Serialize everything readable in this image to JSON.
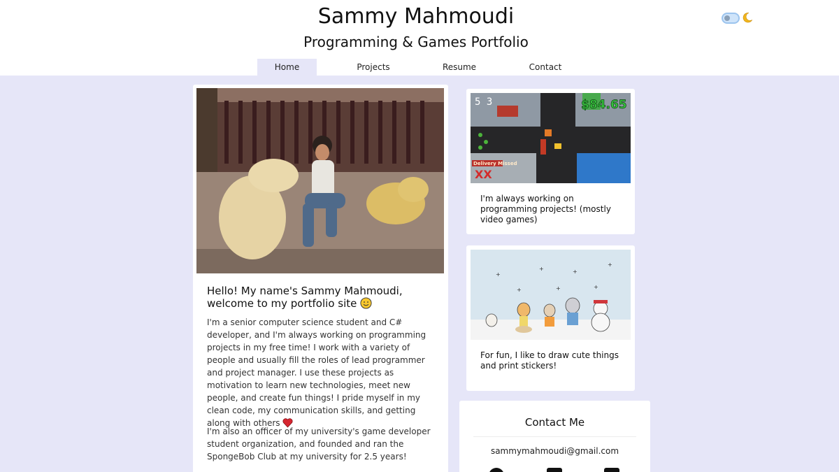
{
  "header": {
    "title": "Sammy Mahmoudi",
    "subtitle": "Programming & Games Portfolio",
    "theme_toggle": {
      "state": "off",
      "icon": "moon-icon"
    }
  },
  "nav": {
    "tabs": [
      {
        "label": "Home",
        "active": true
      },
      {
        "label": "Projects",
        "active": false
      },
      {
        "label": "Resume",
        "active": false
      },
      {
        "label": "Contact",
        "active": false
      }
    ]
  },
  "main": {
    "photo": {
      "subject": "person crouching beside two bear statues"
    },
    "heading": "Hello! My name's Sammy Mahmoudi, welcome to my portfolio site",
    "heading_icon": "smiley-emoji-icon",
    "bio_1": "I'm a senior computer science student and C# developer, and I'm always working on programming projects in my free time! I work with a variety of people and usually fill the roles of lead programmer and project manager. I use these projects as motivation to learn new technologies, meet new people, and create fun things! I pride myself in my clean code, my communication skills, and getting along with others",
    "bio_1_icon": "heart-emoji-icon",
    "bio_2": "I'm also an officer of my university's game developer student organization, and founded and ran the SpongeBob Club at my university for 2.5 years!"
  },
  "side_cards": [
    {
      "game_score": "5 3",
      "game_money": "$84.65",
      "game_banner": "Delivery Missed",
      "caption": "I'm always working on programming projects! (mostly video games)"
    },
    {
      "image": "cartoon cats in snow illustration",
      "caption": "For fun, I like to draw cute things and print stickers!"
    }
  ],
  "contact": {
    "title": "Contact Me",
    "email": "sammymahmoudi@gmail.com",
    "icons": [
      "github-icon",
      "linkedin-icon",
      "mail-icon"
    ]
  },
  "colors": {
    "page_bg": "#e6e6f8",
    "header_bg": "#ffffff",
    "card_bg": "#ffffff",
    "heart": "#d62630"
  }
}
